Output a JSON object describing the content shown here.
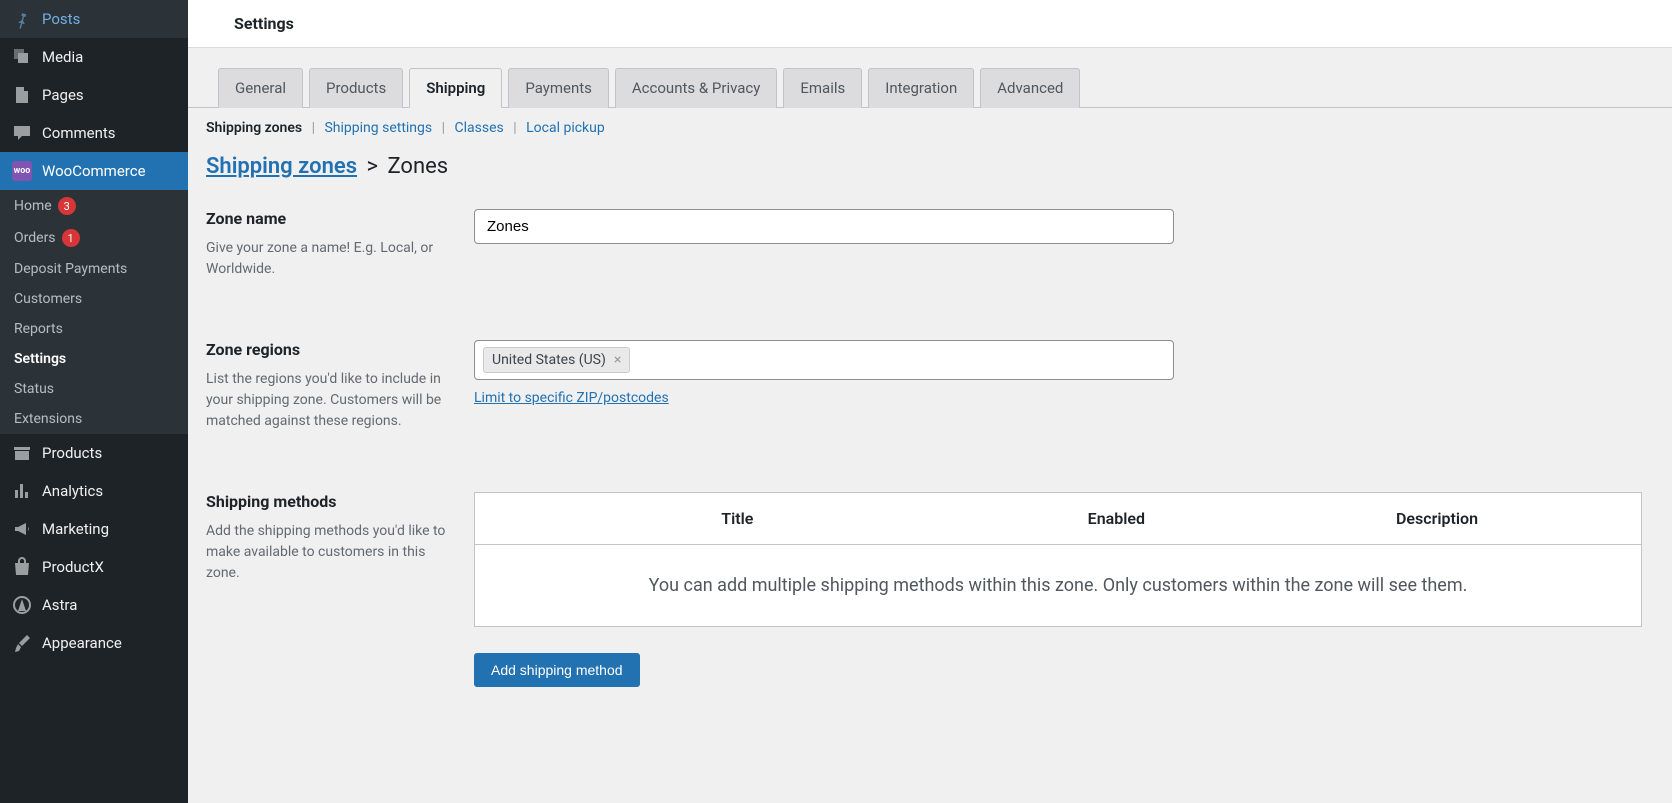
{
  "sidebar": {
    "posts": "Posts",
    "media": "Media",
    "pages": "Pages",
    "comments": "Comments",
    "woocommerce": "WooCommerce",
    "products": "Products",
    "analytics": "Analytics",
    "marketing": "Marketing",
    "productx": "ProductX",
    "astra": "Astra",
    "appearance": "Appearance",
    "woo_badge": "woo",
    "submenu": {
      "home": "Home",
      "home_badge": "3",
      "orders": "Orders",
      "orders_badge": "1",
      "deposit": "Deposit Payments",
      "customers": "Customers",
      "reports": "Reports",
      "settings": "Settings",
      "status": "Status",
      "extensions": "Extensions"
    }
  },
  "header": {
    "title": "Settings"
  },
  "tabs": {
    "general": "General",
    "products": "Products",
    "shipping": "Shipping",
    "payments": "Payments",
    "accounts": "Accounts & Privacy",
    "emails": "Emails",
    "integration": "Integration",
    "advanced": "Advanced"
  },
  "subnav": {
    "zones": "Shipping zones",
    "settings": "Shipping settings",
    "classes": "Classes",
    "local": "Local pickup",
    "sep": " | "
  },
  "breadcrumb": {
    "root": "Shipping zones",
    "sep": ">",
    "current": "Zones"
  },
  "form": {
    "zone_name": {
      "label": "Zone name",
      "help": "Give your zone a name! E.g. Local, or Worldwide.",
      "value": "Zones"
    },
    "zone_regions": {
      "label": "Zone regions",
      "help": "List the regions you'd like to include in your shipping zone. Customers will be matched against these regions.",
      "chip": "United States (US)",
      "chip_x": "×",
      "limit_link": "Limit to specific ZIP/postcodes"
    },
    "methods": {
      "label": "Shipping methods",
      "help": "Add the shipping methods you'd like to make available to customers in this zone.",
      "th_title": "Title",
      "th_enabled": "Enabled",
      "th_desc": "Description",
      "empty": "You can add multiple shipping methods within this zone. Only customers within the zone will see them.",
      "add_btn": "Add shipping method"
    }
  }
}
